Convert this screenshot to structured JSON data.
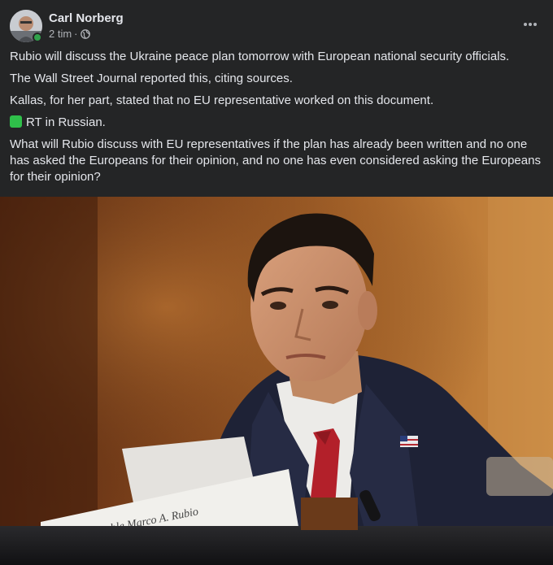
{
  "post": {
    "author": "Carl Norberg",
    "time": "2 tim",
    "separator": "·",
    "privacy_icon": "globe-icon",
    "more_icon": "more-dots-icon",
    "paragraphs": [
      "Rubio will discuss the Ukraine peace plan tomorrow with European national security officials.",
      "The Wall Street Journal reported this, citing sources.",
      "Kallas, for her part, stated that no EU representative worked on this document."
    ],
    "rt_line": "RT in Russian.",
    "rt_emoji": "green-square-emoji",
    "question": "What will Rubio discuss with EU representatives if the plan has already been written and no one has asked the Europeans for their opinion, and no one has even considered asking the Europeans for their opinion?",
    "photo": {
      "nameplate_text": "The Honorable Marco A. Rubio"
    }
  },
  "colors": {
    "background": "#242526",
    "text": "#e4e6eb",
    "secondary_text": "#b0b3b8",
    "online": "#31a24c"
  }
}
